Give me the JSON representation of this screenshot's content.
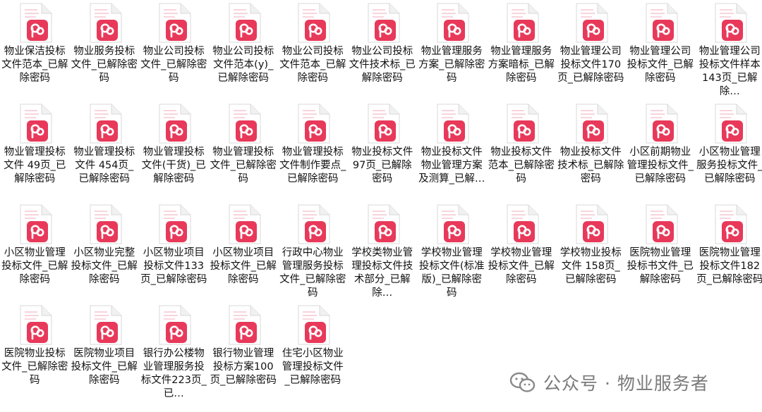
{
  "files": [
    {
      "label": "物业保洁投标文件范本_已解除密码"
    },
    {
      "label": "物业服务投标文件_已解除密码"
    },
    {
      "label": "物业公司投标文件_已解除密码"
    },
    {
      "label": "物业公司投标文件范本(y)_已解除密码"
    },
    {
      "label": "物业公司投标文件范本_已解除密码"
    },
    {
      "label": "物业公司投标文件技术标_已解除密码"
    },
    {
      "label": "物业管理服务方案_已解除密码"
    },
    {
      "label": "物业管理服务方案暗标_已解除密码"
    },
    {
      "label": "物业管理公司投标文件170页_已解除密码"
    },
    {
      "label": "物业管理公司投标文件_已解除密码"
    },
    {
      "label": "物业管理公司投标文件样本 143页_已解除…"
    },
    {
      "label": "物业管理投标文件 49页_已解除密码"
    },
    {
      "label": "物业管理投标文件 454页_已解除密码"
    },
    {
      "label": "物业管理投标文件(干货)_已解除密码"
    },
    {
      "label": "物业管理投标文件_已解除密码"
    },
    {
      "label": "物业管理投标文件制作要点_已解除密码"
    },
    {
      "label": "物业投标文件 97页_已解除密码"
    },
    {
      "label": "物业投标文件 物业管理方案及测算_已解…"
    },
    {
      "label": "物业投标文件范本_已解除密码"
    },
    {
      "label": "物业投标文件技术标_已解除密码"
    },
    {
      "label": "小区前期物业管理投标文件_已解除密码"
    },
    {
      "label": "小区物业管理服务投标文件_已解除密码"
    },
    {
      "label": "小区物业管理投标文件_已解除密码"
    },
    {
      "label": "小区物业完整投标文件_已解除密码"
    },
    {
      "label": "小区物业项目投标文件133页_已解除密码"
    },
    {
      "label": "小区物业项目投标文件_已解除密码"
    },
    {
      "label": "行政中心物业管理服务投标文件_已解除密码"
    },
    {
      "label": "学校类物业管理投标文件技术部分_已解除…"
    },
    {
      "label": "学校物业管理投标文件(标准版)_已解除密码"
    },
    {
      "label": "学校物业管理投标文件_已解除密码"
    },
    {
      "label": "学校物业投标文件 158页_已解除密码"
    },
    {
      "label": "医院物业管理投标书文件_已解除密码"
    },
    {
      "label": "医院物业管理投标文件182页_已解除密码"
    },
    {
      "label": "医院物业投标文件_已解除密码"
    },
    {
      "label": "医院物业项目投标文件_已解除密码"
    },
    {
      "label": "银行办公楼物业管理服务投标文件223页_已…"
    },
    {
      "label": "银行物业管理投标方案100页_已解除密码"
    },
    {
      "label": "住宅小区物业管理投标文件 _已解除密码"
    }
  ],
  "icon": {
    "name": "pdf-file-icon",
    "accent": "#e8395a",
    "accent_dark": "#c9284a"
  },
  "watermark": {
    "text": "公众号 · 物业服务者",
    "icon": "wechat-icon"
  }
}
